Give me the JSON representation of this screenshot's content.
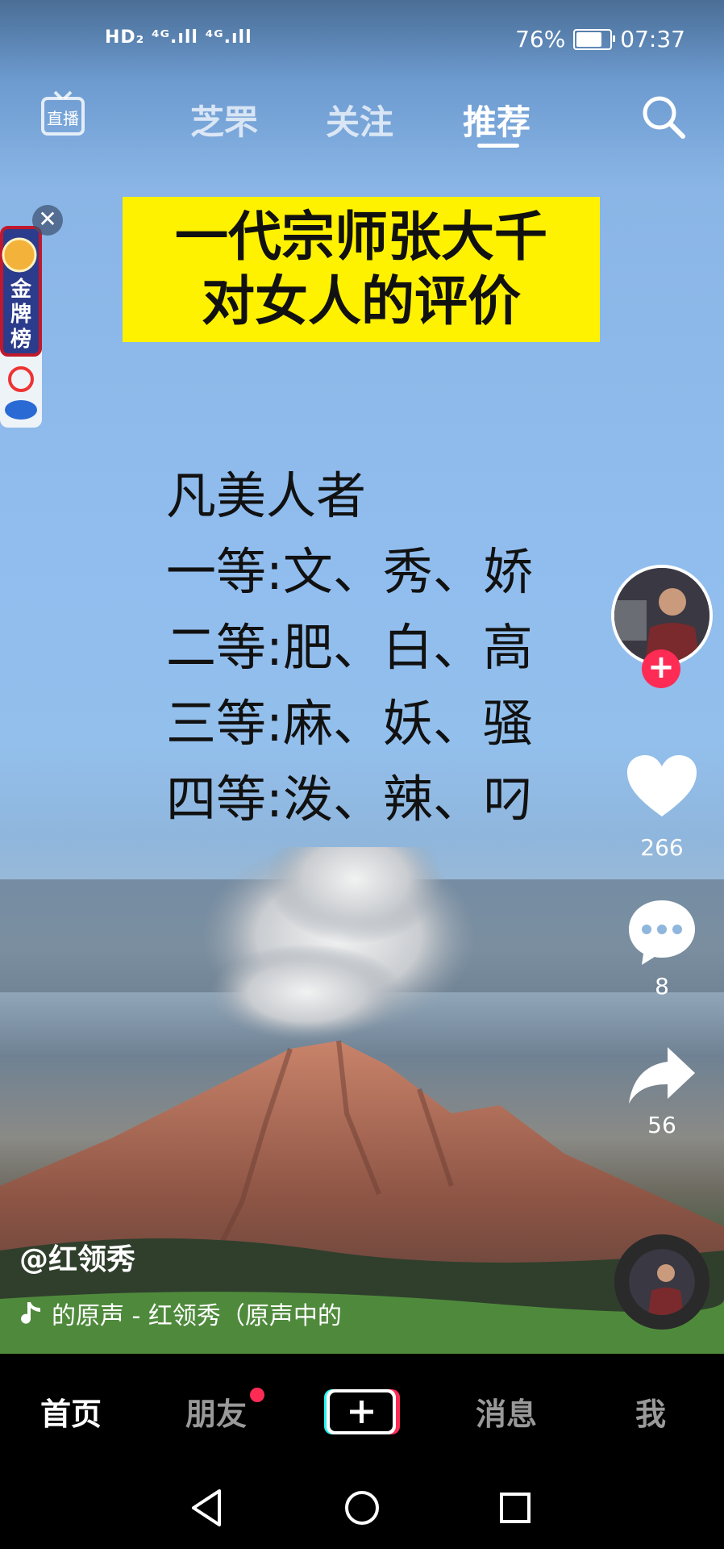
{
  "status_bar": {
    "network": "HD₂ ⁴ᴳ.ıll ⁴ᴳ.ıll",
    "battery": "76%",
    "time": "07:37"
  },
  "top_nav": {
    "live": "直播",
    "tabs": [
      "芝罘",
      "关注",
      "推荐"
    ],
    "active_tab": "推荐"
  },
  "badge": {
    "label": "金牌榜"
  },
  "banner": {
    "line1": "一代宗师张大千",
    "line2": "对女人的评价"
  },
  "poem": [
    "凡美人者",
    "一等:文、秀、娇",
    "二等:肥、白、高",
    "三等:麻、妖、骚",
    "四等:泼、辣、叼"
  ],
  "rail": {
    "likes": "266",
    "comments": "8",
    "shares": "56"
  },
  "caption": {
    "author": "@红领秀",
    "music": "的原声 - 红领秀（原声中的"
  },
  "bottom_nav": {
    "home": "首页",
    "friends": "朋友",
    "messages": "消息",
    "me": "我"
  },
  "colors": {
    "accent": "#fe2c55",
    "banner": "#fff200"
  }
}
